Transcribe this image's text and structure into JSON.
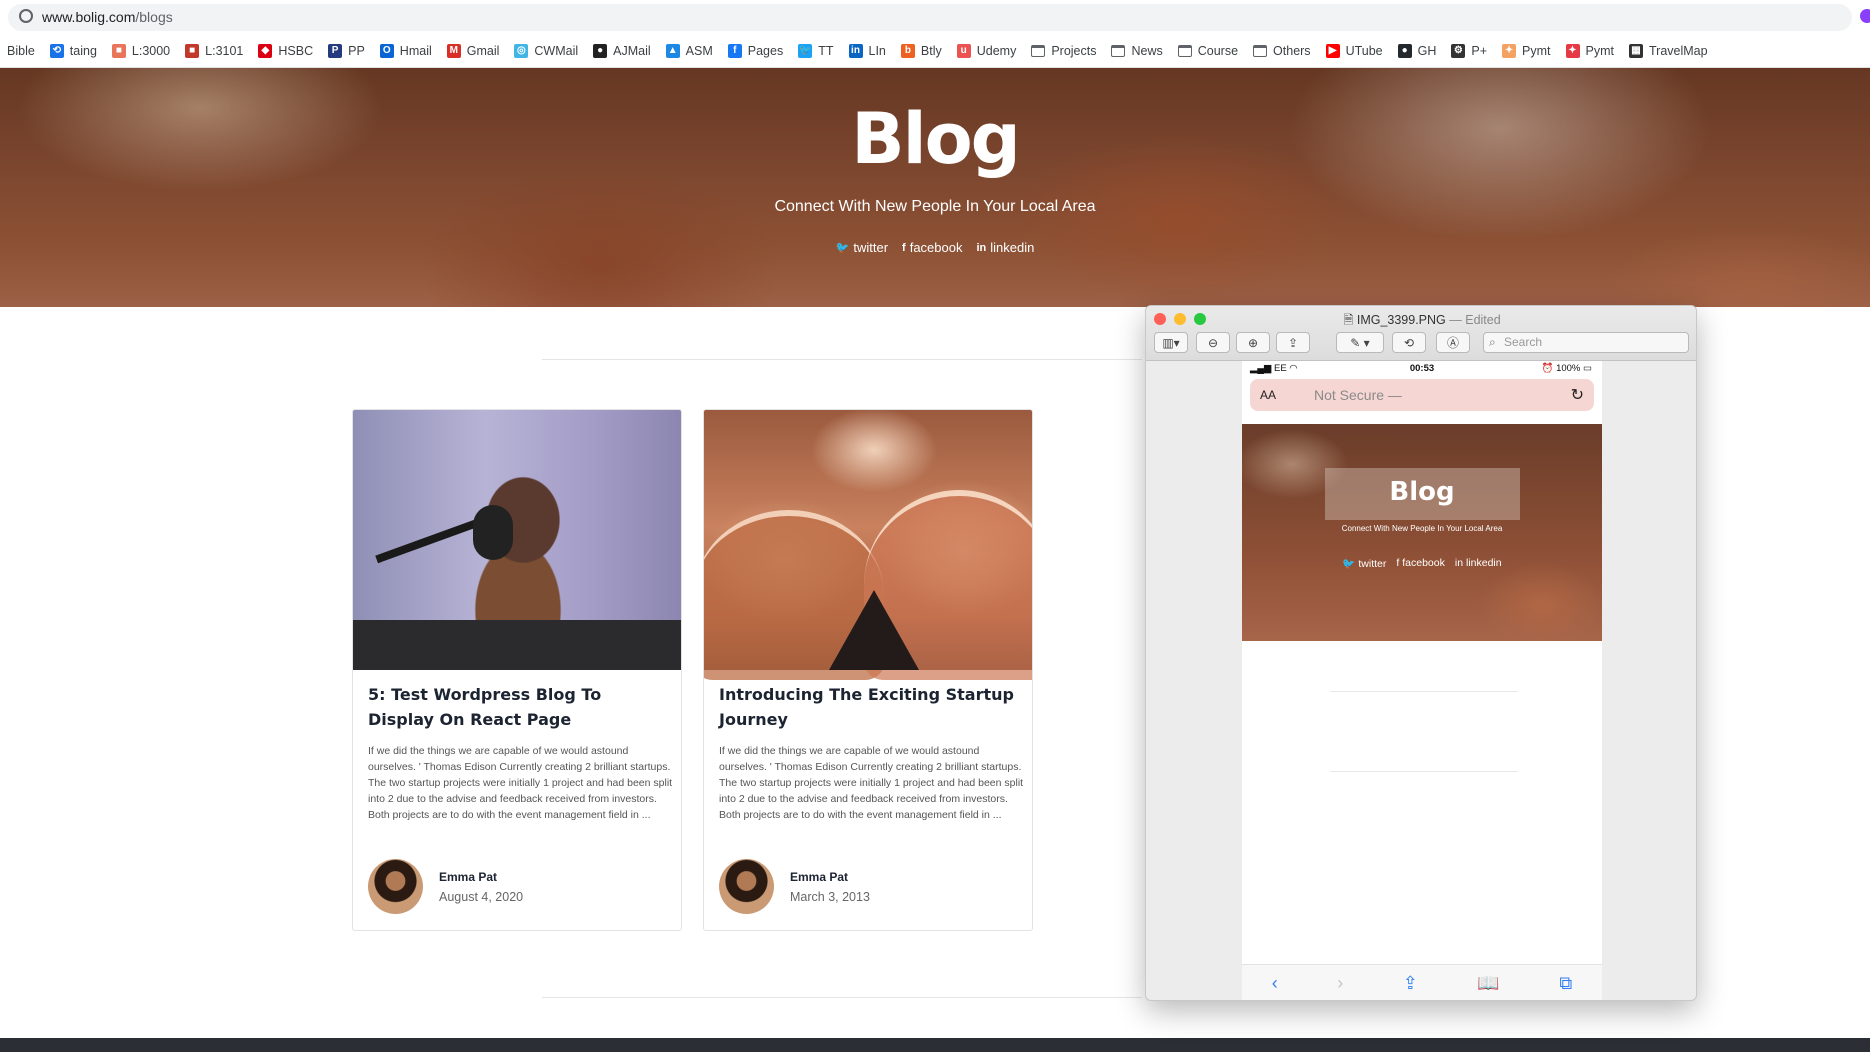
{
  "browser": {
    "url_host": "www.bolig.com",
    "url_path": "/blogs",
    "bookmarks": [
      {
        "label": "Bible",
        "icon": "none",
        "color": ""
      },
      {
        "label": "taing",
        "icon": "history-icon",
        "color": "#1a73e8"
      },
      {
        "label": "L:3000",
        "icon": "app-icon",
        "color": "#e8745a"
      },
      {
        "label": "L:3101",
        "icon": "app-icon",
        "color": "#c0392b"
      },
      {
        "label": "HSBC",
        "icon": "hsbc-icon",
        "color": "#db0011"
      },
      {
        "label": "PP",
        "icon": "paypal-icon",
        "color": "#253b80"
      },
      {
        "label": "Hmail",
        "icon": "outlook-icon",
        "color": "#0a64d6"
      },
      {
        "label": "Gmail",
        "icon": "gmail-icon",
        "color": "#d93025"
      },
      {
        "label": "CWMail",
        "icon": "cwmail-icon",
        "color": "#41b6e6"
      },
      {
        "label": "AJMail",
        "icon": "ajmail-icon",
        "color": "#222222"
      },
      {
        "label": "ASM",
        "icon": "asm-icon",
        "color": "#1e88e5"
      },
      {
        "label": "Pages",
        "icon": "facebook-icon",
        "color": "#1877f2"
      },
      {
        "label": "TT",
        "icon": "twitter-icon",
        "color": "#1da1f2"
      },
      {
        "label": "LIn",
        "icon": "linkedin-icon",
        "color": "#0a66c2"
      },
      {
        "label": "Btly",
        "icon": "bitly-icon",
        "color": "#ee6123"
      },
      {
        "label": "Udemy",
        "icon": "udemy-icon",
        "color": "#ec5252"
      },
      {
        "label": "Projects",
        "icon": "folder-icon",
        "color": ""
      },
      {
        "label": "News",
        "icon": "folder-icon",
        "color": ""
      },
      {
        "label": "Course",
        "icon": "folder-icon",
        "color": ""
      },
      {
        "label": "Others",
        "icon": "folder-icon",
        "color": ""
      },
      {
        "label": "UTube",
        "icon": "youtube-icon",
        "color": "#ff0000"
      },
      {
        "label": "GH",
        "icon": "github-icon",
        "color": "#24292e"
      },
      {
        "label": "P+",
        "icon": "gear-icon",
        "color": "#333333"
      },
      {
        "label": "Pymt",
        "icon": "pymt-icon",
        "color": "#f4a261"
      },
      {
        "label": "Pymt",
        "icon": "pymt-icon",
        "color": "#e63946"
      },
      {
        "label": "TravelMap",
        "icon": "map-icon",
        "color": "#333333"
      }
    ]
  },
  "hero": {
    "title": "Blog",
    "subtitle": "Connect With New People In Your Local Area",
    "social": {
      "twitter": "twitter",
      "facebook": "facebook",
      "linkedin": "linkedin"
    }
  },
  "posts": [
    {
      "title": "5: Test Wordpress Blog To Display On React Page",
      "excerpt": "If we did the things we are capable of we would astound ourselves. ' Thomas Edison Currently creating 2 brilliant startups. The two startup projects were initially 1 project and had been split into 2 due to the advise and feedback received from investors. Both projects are to do with the event management field in ...",
      "author": "Emma Pat",
      "date": "August 4, 2020"
    },
    {
      "title": "Introducing The Exciting Startup Journey",
      "excerpt": "If we did the things we are capable of we would astound ourselves. ' Thomas Edison Currently creating 2 brilliant startups. The two startup projects were initially 1 project and had been split into 2 due to the advise and feedback received from investors. Both projects are to do with the event management field in ...",
      "author": "Emma Pat",
      "date": "March 3, 2013"
    }
  ],
  "preview": {
    "filename": "IMG_3399.PNG",
    "edited": "— Edited",
    "search_placeholder": "Search",
    "phone": {
      "carrier": "EE",
      "time": "00:53",
      "battery": "100%",
      "aa": "AA",
      "url_text": "Not Secure —",
      "blog_title": "Blog",
      "subtitle": "Connect With New People In Your Local Area",
      "social": {
        "twitter": "twitter",
        "facebook": "facebook",
        "linkedin": "linkedin"
      }
    }
  },
  "colors": {
    "footer": "#2c2e36",
    "link": "#2f7df6",
    "title": "#1c2331"
  }
}
